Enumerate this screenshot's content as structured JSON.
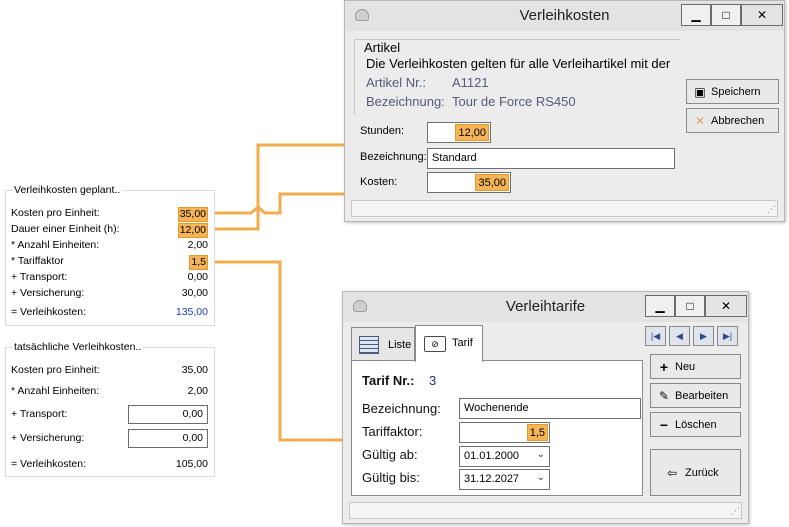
{
  "panel_planned": {
    "title": "Verleihkosten geplant..",
    "rows": [
      {
        "label": "Kosten pro Einheit:",
        "value": "35,00"
      },
      {
        "label": "Dauer einer Einheit (h):",
        "value": "12,00"
      },
      {
        "label": "* Anzahl Einheiten:",
        "value": "2,00"
      },
      {
        "label": "* Tariffaktor",
        "value": "1,5"
      },
      {
        "label": "+ Transport:",
        "value": "0,00"
      },
      {
        "label": "+ Versicherung:",
        "value": "30,00"
      },
      {
        "label": "= Verleihkosten:",
        "value": "135,00"
      }
    ]
  },
  "panel_actual": {
    "title": "tatsächliche Verleihkosten..",
    "rows": [
      {
        "label": "Kosten pro Einheit:",
        "value": "35,00"
      },
      {
        "label": "* Anzahl Einheiten:",
        "value": "2,00"
      },
      {
        "label": "+ Transport:",
        "value": "0,00"
      },
      {
        "label": "+ Versicherung:",
        "value": "0,00"
      },
      {
        "label": "= Verleihkosten:",
        "value": "105,00"
      }
    ]
  },
  "win_kosten": {
    "title": "Verleihkosten",
    "minimize": "▁",
    "maximize": "□",
    "close": "✕",
    "group_title": "Artikel",
    "info_text": "Die Verleihkosten gelten für alle Verleihartikel mit der",
    "artikel_label": "Artikel Nr.:",
    "artikel_value": "A1121",
    "bez_label": "Bezeichnung:",
    "bez_value": "Tour de Force RS450",
    "stunden_label": "Stunden:",
    "stunden_value": "12,00",
    "bezeichnung_label": "Bezeichnung:",
    "bezeichnung_value": "Standard",
    "kosten_label": "Kosten:",
    "kosten_value": "35,00",
    "save_button": "Speichern",
    "cancel_button": "Abbrechen"
  },
  "win_tarife": {
    "title": "Verleihtarife",
    "minimize": "▁",
    "maximize": "□",
    "close": "✕",
    "tab_list": "Liste",
    "tab_tarif": "Tarif",
    "nav_first": "|◀",
    "nav_prev": "◀",
    "nav_next": "▶",
    "nav_last": "▶|",
    "tarif_nr_label": "Tarif Nr.:",
    "tarif_nr_value": "3",
    "bezeichnung_label": "Bezeichnung:",
    "bezeichnung_value": "Wochenende",
    "tariffaktor_label": "Tariffaktor:",
    "tariffaktor_value": "1,5",
    "gueltig_ab_label": "Gültig ab:",
    "gueltig_ab_value": "01.01.2000",
    "gueltig_bis_label": "Gültig bis:",
    "gueltig_bis_value": "31.12.2027",
    "new_button": "Neu",
    "edit_button": "Bearbeiten",
    "delete_button": "Löschen",
    "back_button": "Zurück"
  },
  "colors": {
    "highlight": "#f5b456",
    "connector": "#f2ac4e",
    "total_blue": "#1a3fb0"
  },
  "icons": {
    "save": "floppy-disk-icon",
    "cancel": "x-icon",
    "new": "plus-icon",
    "edit": "pencil-icon",
    "delete": "minus-icon",
    "back": "arrow-left-icon",
    "list": "grid-icon",
    "tarif": "money-icon"
  }
}
